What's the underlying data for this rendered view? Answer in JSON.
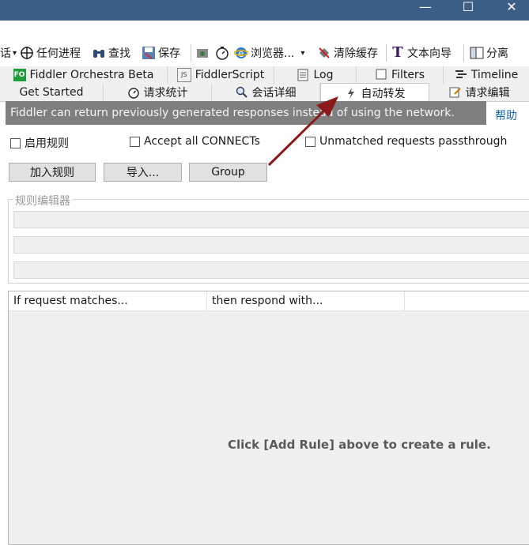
{
  "window": {
    "minimize_glyph": "—",
    "maximize_glyph": "☐",
    "close_glyph": "✕"
  },
  "toolbar": {
    "cut_text": "话",
    "process_label": "任何进程",
    "find_label": "查找",
    "save_label": "保存",
    "browse_label": "浏览器...",
    "clear_cache_label": "清除缓存",
    "text_wizard_label": "文本向导",
    "tearoff_label": "分离",
    "icons": {
      "dropdown": "▾",
      "process": "crosshair-icon",
      "find": "binoculars-icon",
      "save": "save-icon",
      "camera": "camera-icon",
      "timer": "timer-icon",
      "browser": "ie-icon",
      "clear_cache": "clear-cache-icon",
      "text_wizard": "text-wizard-icon",
      "tearoff": "tearoff-icon"
    }
  },
  "tabs_top": [
    {
      "label": "Fiddler Orchestra Beta",
      "icon": "FO"
    },
    {
      "label": "FiddlerScript",
      "icon": "JS"
    },
    {
      "label": "Log",
      "icon": "log-icon"
    },
    {
      "label": "Filters",
      "icon": "checkbox-icon"
    },
    {
      "label": "Timeline",
      "icon": "timeline-icon"
    }
  ],
  "tabs_bottom": [
    {
      "label": "Get Started"
    },
    {
      "label": "请求统计",
      "icon": "timer-icon"
    },
    {
      "label": "会话详细",
      "icon": "inspect-icon"
    },
    {
      "label": "自动转发",
      "icon": "lightning-icon",
      "active": true
    },
    {
      "label": "请求编辑",
      "icon": "edit-icon"
    }
  ],
  "autoresponder": {
    "info_text": "Fiddler can return previously generated responses instead of using the network.",
    "help_link": "帮助",
    "enable_rules_label": "启用规则",
    "accept_connects_label": "Accept all CONNECTs",
    "unmatched_label": "Unmatched requests passthrough",
    "add_rule_button": "加入规则",
    "import_button": "导入...",
    "group_button": "Group",
    "editor_legend": "规则编辑器",
    "list_columns": [
      "If request matches...",
      "then respond with..."
    ],
    "empty_message": "Click [Add Rule] above to create a rule."
  },
  "colors": {
    "titlebar": "#3b5f87",
    "info_strip": "#7f7f7f",
    "annotation_arrow": "#8b1a1a",
    "link": "#1466b8"
  }
}
